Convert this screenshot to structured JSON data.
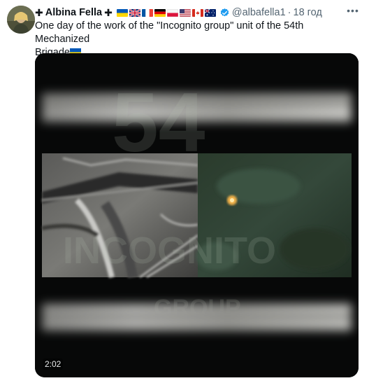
{
  "author": {
    "prefix_cross": "✚",
    "name": "Albina Fella",
    "suffix_cross": "✚",
    "handle": "@albafella1",
    "separator": "·",
    "time": "18 год"
  },
  "flags": [
    "ukraine-flag",
    "uk-flag",
    "france-flag",
    "germany-flag",
    "poland-flag",
    "usa-flag",
    "canada-flag",
    "australia-flag"
  ],
  "tweet": {
    "text_line1": "One day of the work of the \"Incognito group\" unit of the 54th Mechanized",
    "text_line2": "Brigade"
  },
  "media": {
    "duration": "2:02",
    "watermark_number": "54",
    "watermark_line1": "INCOGNITO",
    "watermark_line2": "GROUP"
  },
  "colors": {
    "verified": "#1d9bf0",
    "muted_text": "#536471",
    "text": "#0f1419"
  }
}
